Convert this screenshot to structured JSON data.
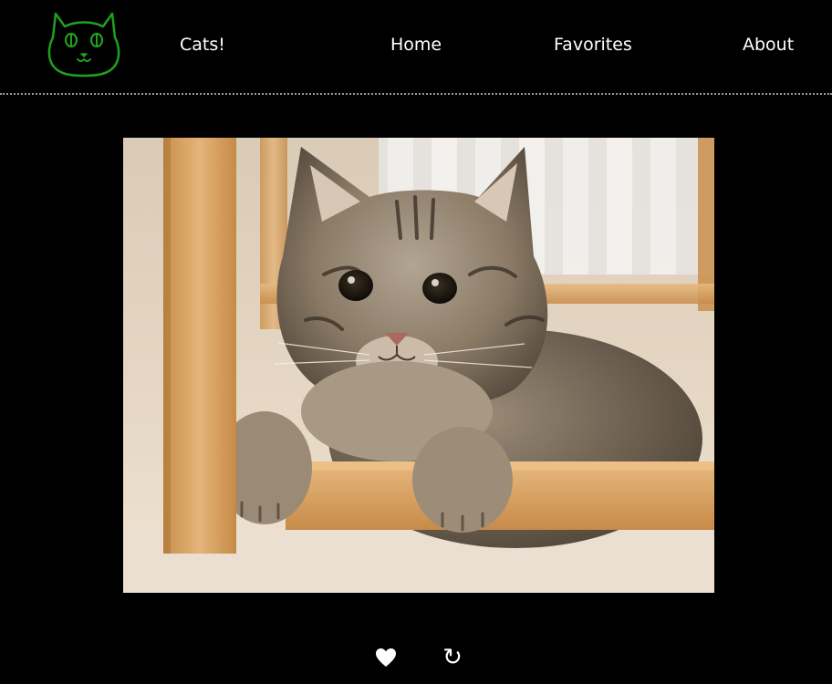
{
  "header": {
    "logo_icon": "cat-face-icon",
    "brand": "Cats!",
    "nav": {
      "home": "Home",
      "favorites": "Favorites",
      "about": "About"
    }
  },
  "colors": {
    "background": "#000000",
    "accent": "#1fa01f",
    "text": "#ffffff",
    "divider": "#9a9a9a"
  },
  "main": {
    "image_alt_icon": "cat-photo",
    "actions": {
      "favorite_icon": "heart-icon",
      "refresh_icon": "refresh-icon",
      "refresh_glyph": "↻"
    }
  }
}
